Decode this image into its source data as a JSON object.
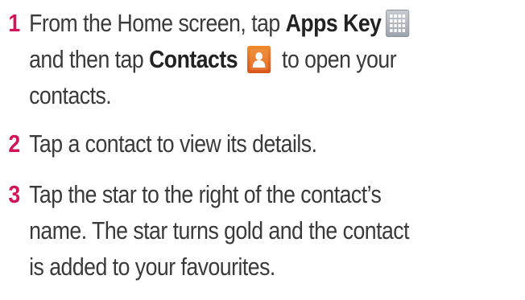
{
  "steps": [
    {
      "number": "1",
      "lines": [
        {
          "pre": "From the Home screen, tap ",
          "bold": "Apps Key",
          "post": ""
        },
        {
          "pre": "and then tap ",
          "bold": "Contacts",
          "post": " to open your"
        },
        {
          "pre": "contacts.",
          "bold": "",
          "post": ""
        }
      ],
      "icons": [
        "apps-grid-icon",
        "contacts-person-icon"
      ]
    },
    {
      "number": "2",
      "lines": [
        {
          "pre": "Tap a contact to view its details.",
          "bold": "",
          "post": ""
        }
      ]
    },
    {
      "number": "3",
      "lines": [
        {
          "pre": "Tap the star to the right of the contact’s",
          "bold": "",
          "post": ""
        },
        {
          "pre": "name. The star turns gold and the contact",
          "bold": "",
          "post": ""
        },
        {
          "pre": "is added to your favourites.",
          "bold": "",
          "post": ""
        }
      ]
    }
  ],
  "colors": {
    "number": "#d4145a",
    "text": "#3a3a3a"
  }
}
